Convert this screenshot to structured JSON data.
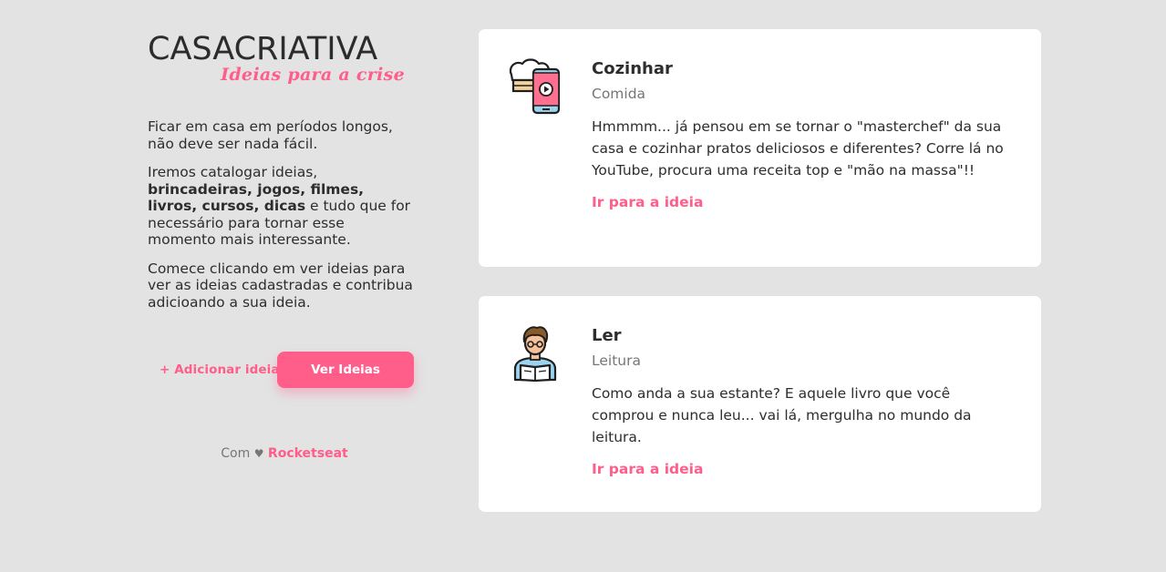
{
  "logo": {
    "part1": "CASA",
    "part2": "CRIATIVA",
    "tagline": "Ideias para a crise"
  },
  "intro": {
    "p1": "Ficar em casa em períodos longos, não deve ser nada fácil.",
    "p2_start": "Iremos catalogar ideias, ",
    "p2_bold": "brincadeiras, jogos, filmes, livros, cursos, dicas",
    "p2_end": " e tudo que for necessário para tornar esse momento mais interessante.",
    "p3": "Comece clicando em ver ideias para ver as ideias cadastradas e contribua adicioando a sua ideia."
  },
  "actions": {
    "add_label": "+ Adicionar ideia",
    "view_label": "Ver Ideias"
  },
  "footer": {
    "prefix": "Com",
    "heart": "♥",
    "brand": "Rocketseat"
  },
  "ideas": [
    {
      "title": "Cozinhar",
      "category": "Comida",
      "description": "Hmmmm... já pensou em se tornar o \"masterchef\" da sua casa e cozinhar pratos deliciosos e diferentes? Corre lá no YouTube, procura uma receita top e \"mão na massa\"!!",
      "link": "Ir para a ideia",
      "icon": "chef-video-icon"
    },
    {
      "title": "Ler",
      "category": "Leitura",
      "description": "Como anda a sua estante? E aquele livro que você comprou e nunca leu... vai lá, mergulha no mundo da leitura.",
      "link": "Ir para a ideia",
      "icon": "reader-icon"
    }
  ],
  "colors": {
    "accent": "#ff5d8a",
    "background": "#e3e3e3",
    "card": "#ffffff",
    "text": "#2d2d2d",
    "muted": "#767676"
  }
}
